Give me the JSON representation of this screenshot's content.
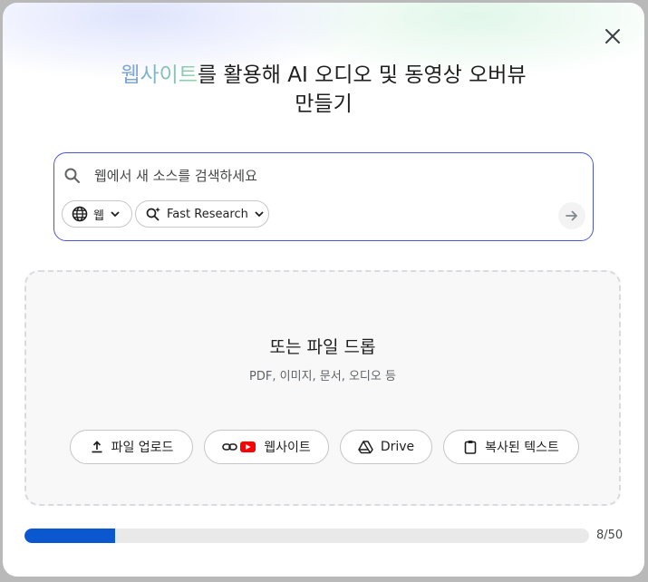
{
  "dialog": {
    "title_highlight": "웹사이트",
    "title_rest": "를 활용해 AI 오디오 및 동영상 오버뷰",
    "title_line2": "만들기",
    "close_icon": "close-icon"
  },
  "search": {
    "placeholder": "웹에서 새 소스를 검색하세요",
    "source_label": "웹",
    "mode_label": "Fast Research",
    "icons": [
      "search-icon",
      "globe-icon",
      "chevron-down-icon",
      "sparkle-search-icon",
      "arrow-right-icon"
    ],
    "accent": "#4a56d6"
  },
  "dropzone": {
    "title": "또는 파일 드롭",
    "subtitle": "PDF, 이미지, 문서, 오디오 등",
    "buttons": [
      {
        "label": "파일 업로드",
        "icon": "upload-icon"
      },
      {
        "label": "웹사이트",
        "icon": "link-youtube-icon"
      },
      {
        "label": "Drive",
        "icon": "drive-icon"
      },
      {
        "label": "복사된 텍스트",
        "icon": "clipboard-icon"
      }
    ]
  },
  "progress": {
    "current": 8,
    "max": 50,
    "label": "8/50",
    "fraction": 0.16,
    "color": "#0b57d0"
  }
}
